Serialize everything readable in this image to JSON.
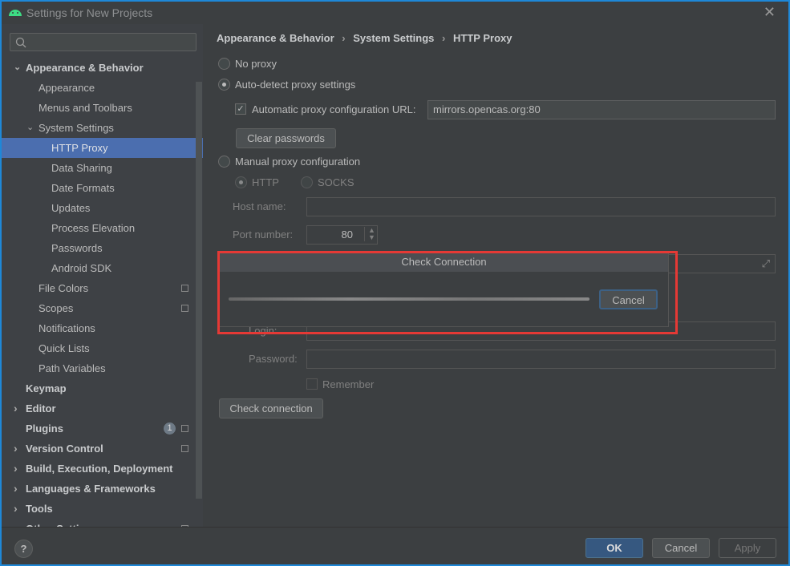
{
  "window": {
    "title": "Settings for New Projects",
    "close_icon": "close-icon",
    "logo_icon": "android-icon"
  },
  "search": {
    "placeholder": "",
    "value": ""
  },
  "sidebar": {
    "items": [
      {
        "label": "Appearance & Behavior",
        "level": 0,
        "bold": true,
        "expanded": true
      },
      {
        "label": "Appearance",
        "level": 1
      },
      {
        "label": "Menus and Toolbars",
        "level": 1
      },
      {
        "label": "System Settings",
        "level": 1,
        "expanded": true
      },
      {
        "label": "HTTP Proxy",
        "level": 2,
        "selected": true
      },
      {
        "label": "Data Sharing",
        "level": 2
      },
      {
        "label": "Date Formats",
        "level": 2
      },
      {
        "label": "Updates",
        "level": 2
      },
      {
        "label": "Process Elevation",
        "level": 2
      },
      {
        "label": "Passwords",
        "level": 2
      },
      {
        "label": "Android SDK",
        "level": 2
      },
      {
        "label": "File Colors",
        "level": 1,
        "copy": true
      },
      {
        "label": "Scopes",
        "level": 1,
        "copy": true
      },
      {
        "label": "Notifications",
        "level": 1
      },
      {
        "label": "Quick Lists",
        "level": 1
      },
      {
        "label": "Path Variables",
        "level": 1
      },
      {
        "label": "Keymap",
        "level": 0,
        "bold": true
      },
      {
        "label": "Editor",
        "level": 0,
        "bold": true,
        "collapsed": true
      },
      {
        "label": "Plugins",
        "level": 0,
        "bold": true,
        "badge": "1",
        "copy": true
      },
      {
        "label": "Version Control",
        "level": 0,
        "bold": true,
        "collapsed": true,
        "copy": true
      },
      {
        "label": "Build, Execution, Deployment",
        "level": 0,
        "bold": true,
        "collapsed": true
      },
      {
        "label": "Languages & Frameworks",
        "level": 0,
        "bold": true,
        "collapsed": true
      },
      {
        "label": "Tools",
        "level": 0,
        "bold": true,
        "collapsed": true
      },
      {
        "label": "Other Settings",
        "level": 0,
        "bold": true,
        "collapsed": true,
        "copy": true
      }
    ]
  },
  "breadcrumb": [
    "Appearance & Behavior",
    "System Settings",
    "HTTP Proxy"
  ],
  "proxy": {
    "no_proxy": "No proxy",
    "auto_detect": "Auto-detect proxy settings",
    "selected": "auto_detect",
    "auto_url_label": "Automatic proxy configuration URL:",
    "auto_url_checked": true,
    "auto_url_value": "mirrors.opencas.org:80",
    "clear_passwords": "Clear passwords",
    "manual": "Manual proxy configuration",
    "http": "HTTP",
    "socks": "SOCKS",
    "host_label": "Host name:",
    "host_value": "",
    "port_label": "Port number:",
    "port_value": "80",
    "login_label": "Login:",
    "password_label": "Password:",
    "remember": "Remember",
    "check_connection": "Check connection"
  },
  "dialog": {
    "title": "Check Connection",
    "cancel": "Cancel",
    "highlight_color": "#e53935"
  },
  "footer": {
    "help": "?",
    "ok": "OK",
    "cancel": "Cancel",
    "apply": "Apply"
  },
  "colors": {
    "selection": "#4b6eaf",
    "accent_border": "#1e88d8"
  }
}
